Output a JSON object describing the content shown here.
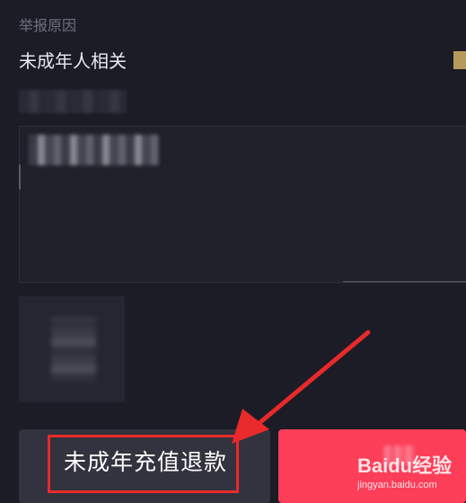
{
  "report": {
    "section_label": "举报原因",
    "reason_value": "未成年人相关"
  },
  "actions": {
    "left_button_label": "未成年充值退款",
    "right_button_label": ""
  },
  "watermark": {
    "brand": "Baidu经验",
    "url": "jingyan.baidu.com"
  },
  "colors": {
    "background": "#1b1c26",
    "left_button": "#32333e",
    "right_button": "#fc3e59",
    "highlight": "#e82a2a",
    "check": "#b59a5b"
  }
}
